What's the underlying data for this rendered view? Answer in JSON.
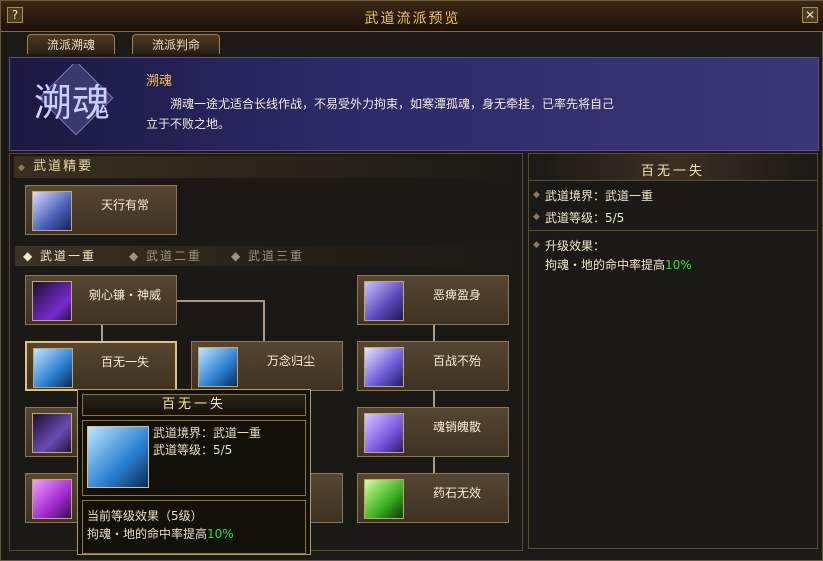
{
  "window": {
    "title": "武道流派预览",
    "help_label": "?",
    "close_label": "✕"
  },
  "tabs": [
    {
      "label": "流派溯魂"
    },
    {
      "label": "流派判命"
    }
  ],
  "banner": {
    "emblem_text": "溯魂",
    "heading": "溯魂",
    "description": "溯魂一途尤适合长线作战，不易受外力拘束，如寒潭孤魂，身无牵挂，已率先将自己立于不败之地。"
  },
  "essentials": {
    "header": "武道精要",
    "skill": {
      "name": "天行有常",
      "icon": "spirit-figure-icon"
    }
  },
  "levels": {
    "tabs": [
      {
        "label": "武道一重"
      },
      {
        "label": "武道二重"
      },
      {
        "label": "武道三重"
      }
    ]
  },
  "skills": {
    "s1": {
      "name": "剜心镰・神威",
      "icon": "scythe-icon"
    },
    "s2": {
      "name": "恶痺盈身",
      "icon": "crawling-figure-icon"
    },
    "s3": {
      "name": "百无一失",
      "icon": "spirit-figure-icon"
    },
    "s4": {
      "name": "万念归尘",
      "icon": "spirit-figure-icon"
    },
    "s5": {
      "name": "百战不殆",
      "icon": "sword-volley-icon"
    },
    "s6": {
      "name": "魂销魄散",
      "icon": "claw-icon"
    },
    "s7": {
      "name": "药石无效",
      "icon": "green-spirit-icon"
    }
  },
  "tooltip": {
    "title": "百无一失",
    "realm_line": "武道境界：武道一重",
    "level_line": "武道等级：5/5",
    "effect_header": "当前等级效果（5级）",
    "effect_text": "拘魂・地的命中率提高",
    "effect_value": "10%"
  },
  "detail": {
    "title": "百无一失",
    "realm_line": "武道境界：武道一重",
    "level_line": "武道等级：5/5",
    "upgrade_header": "升级效果：",
    "upgrade_text": "拘魂・地的命中率提高",
    "upgrade_value": "10%"
  },
  "colors": {
    "accent_gold": "#e7c36c",
    "banner_blue": "#2c2a68",
    "value_green": "#30e030"
  }
}
